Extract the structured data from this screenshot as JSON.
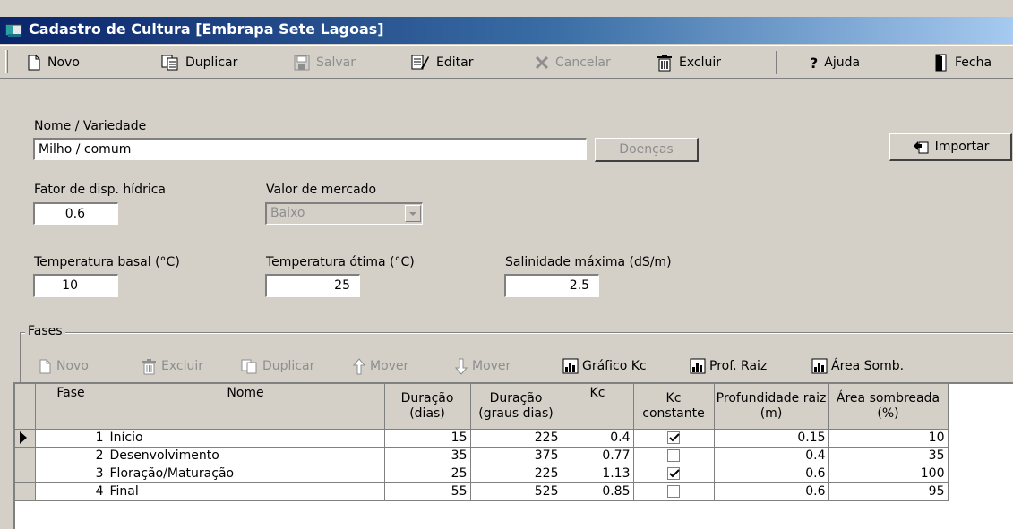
{
  "window": {
    "title": "Cadastro de Cultura [Embrapa Sete Lagoas]",
    "app_icon": "app-book-icon"
  },
  "toolbar": {
    "novo": "Novo",
    "duplicar": "Duplicar",
    "salvar": "Salvar",
    "editar": "Editar",
    "cancelar": "Cancelar",
    "excluir": "Excluir",
    "ajuda": "Ajuda",
    "fechar": "Fecha"
  },
  "form": {
    "nome_label": "Nome / Variedade",
    "nome_value": "Milho / comum",
    "doencas_button": "Doenças",
    "importar_button": "Importar",
    "fator_label": "Fator de disp. hídrica",
    "fator_value": "0.6",
    "valor_mercado_label": "Valor de mercado",
    "valor_mercado_value": "Baixo",
    "temp_basal_label": "Temperatura basal (°C)",
    "temp_basal_value": "10",
    "temp_otima_label": "Temperatura ótima (°C)",
    "temp_otima_value": "25",
    "salinidade_label": "Salinidade máxima (dS/m)",
    "salinidade_value": "2.5"
  },
  "fases": {
    "group_title": "Fases",
    "toolbar": {
      "novo": "Novo",
      "excluir": "Excluir",
      "duplicar": "Duplicar",
      "mover_up": "Mover",
      "mover_down": "Mover",
      "grafico_kc": "Gráfico Kc",
      "prof_raiz": "Prof. Raiz",
      "area_somb": "Área Somb."
    },
    "columns": {
      "fase": "Fase",
      "nome": "Nome",
      "duracao_dias": "Duração (dias)",
      "duracao_graus": "Duração (graus dias)",
      "kc": "Kc",
      "kc_constante": "Kc constante",
      "prof_raiz": "Profundidade raiz (m)",
      "area_sombreada": "Área sombreada (%)"
    },
    "rows": [
      {
        "fase": "1",
        "nome": "Início",
        "duracao_dias": "15",
        "duracao_graus": "225",
        "kc": "0.4",
        "kc_constante": true,
        "prof_raiz": "0.15",
        "area": "10",
        "current": true
      },
      {
        "fase": "2",
        "nome": "Desenvolvimento",
        "duracao_dias": "35",
        "duracao_graus": "375",
        "kc": "0.77",
        "kc_constante": false,
        "prof_raiz": "0.4",
        "area": "35",
        "current": false
      },
      {
        "fase": "3",
        "nome": "Floração/Maturação",
        "duracao_dias": "25",
        "duracao_graus": "225",
        "kc": "1.13",
        "kc_constante": true,
        "prof_raiz": "0.6",
        "area": "100",
        "current": false
      },
      {
        "fase": "4",
        "nome": "Final",
        "duracao_dias": "55",
        "duracao_graus": "525",
        "kc": "0.85",
        "kc_constante": false,
        "prof_raiz": "0.6",
        "area": "95",
        "current": false
      }
    ]
  }
}
